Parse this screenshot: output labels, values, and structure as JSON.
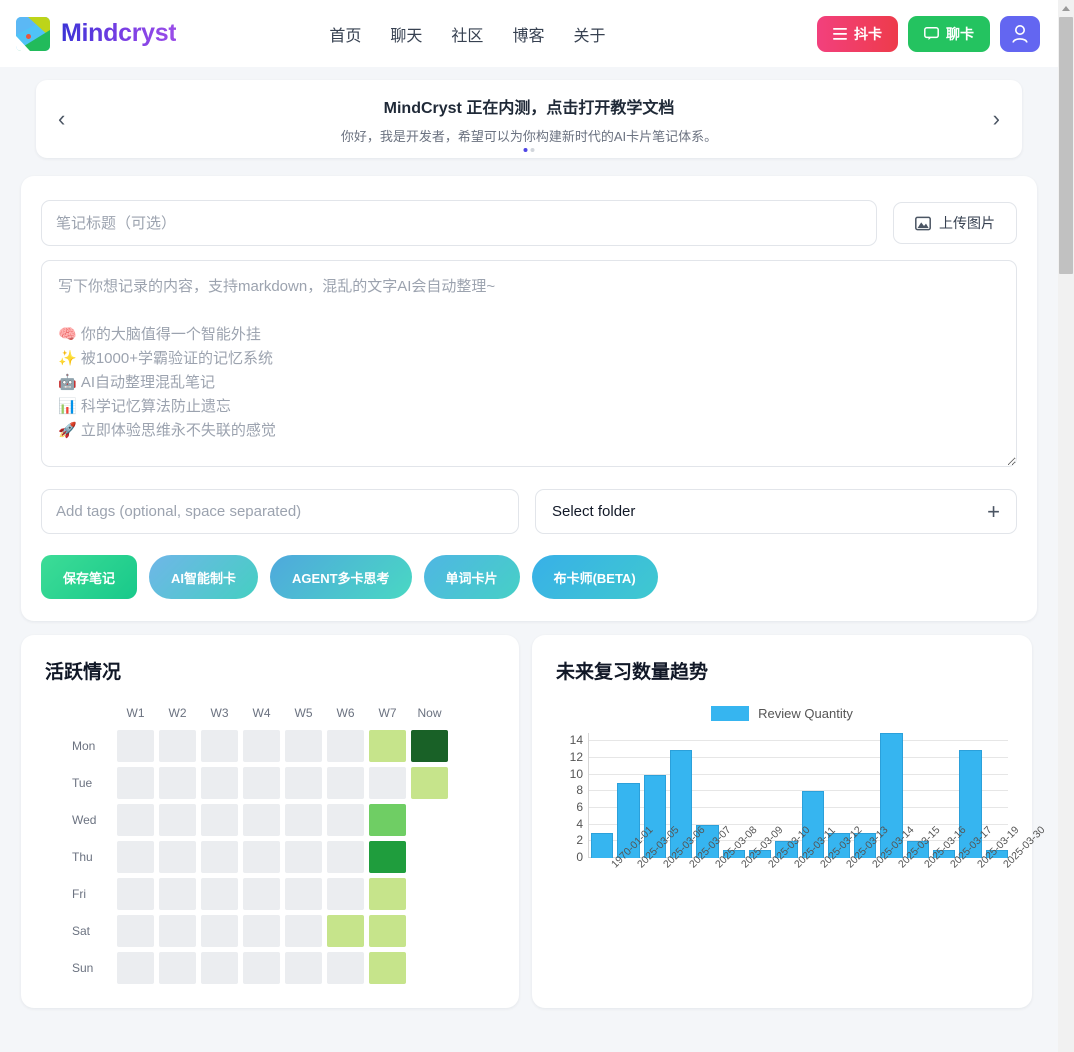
{
  "header": {
    "brand": "Mindcryst",
    "nav": [
      {
        "label": "首页"
      },
      {
        "label": "聊天"
      },
      {
        "label": "社区"
      },
      {
        "label": "博客"
      },
      {
        "label": "关于"
      }
    ],
    "actions": {
      "dou_label": "抖卡",
      "liao_label": "聊卡",
      "dou_color": "#ee3b4b",
      "liao_color": "#24c360",
      "user_color": "#6366f1"
    }
  },
  "banner": {
    "title": "MindCryst 正在内测，点击打开教学文档",
    "subtitle": "你好，我是开发者，希望可以为你构建新时代的AI卡片笔记体系。",
    "prev": "‹",
    "next": "›"
  },
  "composer": {
    "title_placeholder": "笔记标题（可选）",
    "title_value": "",
    "upload_label": "上传图片",
    "note_placeholder": "写下你想记录的内容，支持markdown，混乱的文字AI会自动整理~\n\n🧠 你的大脑值得一个智能外挂\n✨ 被1000+学霸验证的记忆系统\n🤖 AI自动整理混乱笔记\n📊 科学记忆算法防止遗忘\n🚀 立即体验思维永不失联的感觉",
    "note_value": "",
    "tags_placeholder": "Add tags (optional, space separated)",
    "tags_value": "",
    "folder_label": "Select folder",
    "folder_plus": "+",
    "buttons": [
      {
        "label": "保存笔记"
      },
      {
        "label": "AI智能制卡"
      },
      {
        "label": "AGENT多卡思考"
      },
      {
        "label": "单词卡片"
      },
      {
        "label": "布卡师(BETA)"
      }
    ]
  },
  "activity": {
    "title": "活跃情况",
    "columns": [
      "W1",
      "W2",
      "W3",
      "W4",
      "W5",
      "W6",
      "W7",
      "Now"
    ],
    "rows": [
      {
        "day": "Mon",
        "levels": [
          0,
          0,
          0,
          0,
          0,
          0,
          1,
          4
        ]
      },
      {
        "day": "Tue",
        "levels": [
          0,
          0,
          0,
          0,
          0,
          0,
          0,
          1
        ]
      },
      {
        "day": "Wed",
        "levels": [
          0,
          0,
          0,
          0,
          0,
          0,
          2,
          -1
        ]
      },
      {
        "day": "Thu",
        "levels": [
          0,
          0,
          0,
          0,
          0,
          0,
          3,
          -1
        ]
      },
      {
        "day": "Fri",
        "levels": [
          0,
          0,
          0,
          0,
          0,
          0,
          1,
          -1
        ]
      },
      {
        "day": "Sat",
        "levels": [
          0,
          0,
          0,
          0,
          0,
          1,
          1,
          -1
        ]
      },
      {
        "day": "Sun",
        "levels": [
          0,
          0,
          0,
          0,
          0,
          0,
          1,
          -1
        ]
      }
    ],
    "legend_colors": [
      "#ebedf0",
      "#c6e48b",
      "#6fce64",
      "#1f9d3d",
      "#196127"
    ]
  },
  "review": {
    "title": "未来复习数量趋势"
  },
  "chart_data": {
    "type": "bar",
    "title": "未来复习数量趋势",
    "xlabel": "",
    "ylabel": "",
    "legend": [
      "Review Quantity"
    ],
    "legend_position": "top-center",
    "series_color": "#36b5f0",
    "grid": true,
    "ylim": [
      0,
      15
    ],
    "yticks": [
      0,
      2,
      4,
      6,
      8,
      10,
      12,
      14
    ],
    "categories": [
      "1970-01-01",
      "2025-03-05",
      "2025-03-06",
      "2025-03-07",
      "2025-03-08",
      "2025-03-09",
      "2025-03-10",
      "2025-03-11",
      "2025-03-12",
      "2025-03-13",
      "2025-03-14",
      "2025-03-15",
      "2025-03-16",
      "2025-03-17",
      "2025-03-19",
      "2025-03-30"
    ],
    "series": [
      {
        "name": "Review Quantity",
        "values": [
          3,
          9,
          10,
          13,
          4,
          1,
          1,
          2,
          8,
          3,
          3,
          15,
          2,
          1,
          13,
          1
        ]
      }
    ]
  }
}
